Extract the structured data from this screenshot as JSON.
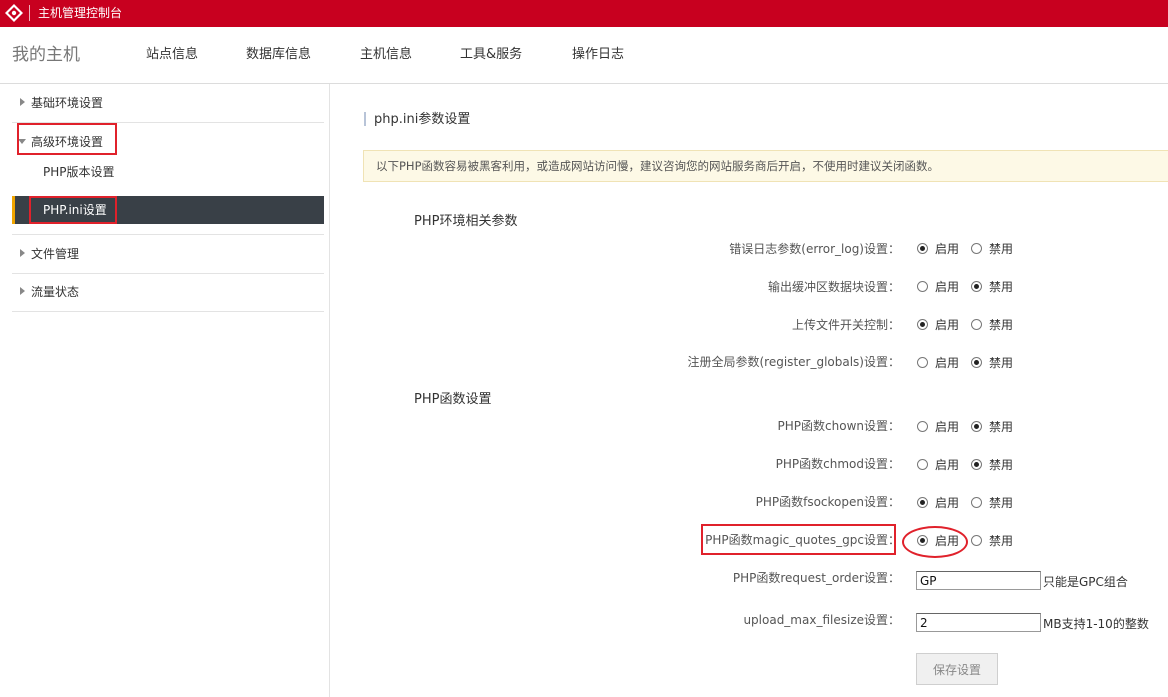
{
  "header": {
    "app_title": "主机管理控制台",
    "brand_color": "#c8001f"
  },
  "nav": {
    "brand": "我的主机",
    "items": [
      "站点信息",
      "数据库信息",
      "主机信息",
      "工具&服务",
      "操作日志"
    ]
  },
  "sidebar": {
    "groups": [
      {
        "label": "基础环境设置",
        "expanded": false
      },
      {
        "label": "高级环境设置",
        "expanded": true,
        "children": [
          "PHP版本设置",
          "PHP.ini设置"
        ],
        "active_child": "PHP.ini设置"
      },
      {
        "label": "文件管理",
        "expanded": false
      },
      {
        "label": "流量状态",
        "expanded": false
      }
    ]
  },
  "main": {
    "section_title": "php.ini参数设置",
    "notice": "以下PHP函数容易被黑客利用，或造成网站访问慢，建议咨询您的网站服务商后开启，不使用时建议关闭函数。",
    "env_group": {
      "title": "PHP环境相关参数",
      "rows": [
        {
          "label": "错误日志参数(error_log)设置：",
          "value": "启用"
        },
        {
          "label": "输出缓冲区数据块设置：",
          "value": "禁用"
        },
        {
          "label": "上传文件开关控制：",
          "value": "启用"
        },
        {
          "label": "注册全局参数(register_globals)设置：",
          "value": "禁用"
        }
      ]
    },
    "func_group": {
      "title": "PHP函数设置",
      "rows": [
        {
          "label": "PHP函数chown设置：",
          "value": "禁用"
        },
        {
          "label": "PHP函数chmod设置：",
          "value": "禁用"
        },
        {
          "label": "PHP函数fsockopen设置：",
          "value": "启用"
        },
        {
          "label": "PHP函数magic_quotes_gpc设置：",
          "value": "启用"
        }
      ]
    },
    "options": {
      "enable": "启用",
      "disable": "禁用"
    },
    "request_order": {
      "label": "PHP函数request_order设置：",
      "value": "GP",
      "hint": "只能是GPC组合"
    },
    "upload_max": {
      "label": "upload_max_filesize设置：",
      "value": "2",
      "hint": "MB支持1-10的整数"
    },
    "save_label": "保存设置"
  }
}
